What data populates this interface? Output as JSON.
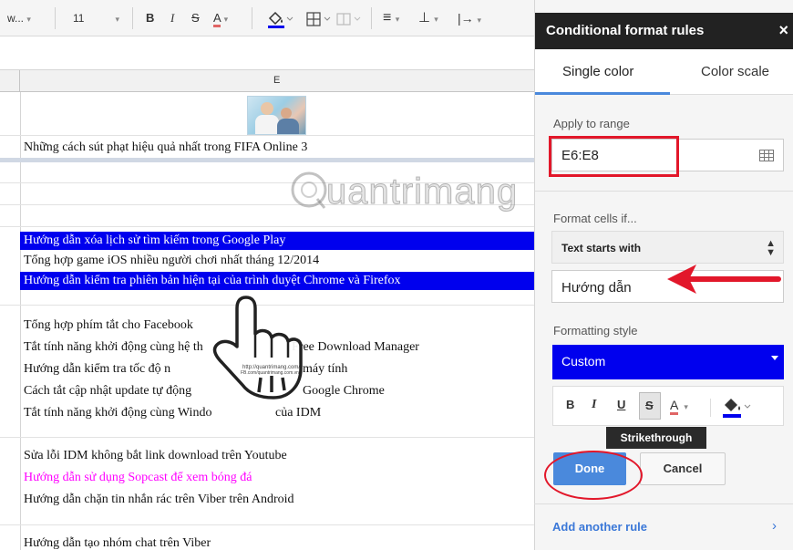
{
  "toolbar": {
    "font_name": "w...",
    "font_size": "11",
    "bold": "B",
    "italic": "I",
    "strike": "S",
    "text_color": "A",
    "align": "≡",
    "valign": "⊥",
    "wrap": "|→"
  },
  "sheet": {
    "column_header": "E",
    "rows": [
      "Những cách sút phạt hiệu quả nhất trong FIFA Online 3",
      "Hướng dẫn xóa lịch sử tìm kiếm trong Google Play",
      "Tổng hợp game iOS nhiều người chơi nhất tháng 12/2014",
      "Hướng dẫn kiểm tra phiên bản hiện tại của trình duyệt Chrome và Firefox",
      "Tổng hợp phím tắt cho Facebook",
      "Tắt tính năng khởi động cùng hệ th",
      "Free Download Manager",
      "Hướng dẫn kiểm tra tốc độ n",
      "máy tính",
      "Cách tắt cập nhật update tự động",
      "Google Chrome",
      "Tắt tính năng khởi động cùng Windo",
      "của IDM",
      "Sửa lỗi IDM không bắt link download trên Youtube",
      "Hướng dẫn sử dụng Sopcast để xem bóng đá",
      "Hướng dẫn chặn tin nhắn rác trên Viber trên Android",
      "Hướng dẫn tạo nhóm chat trên Viber"
    ],
    "highlight_color": "#0000ee",
    "magenta_color": "#ff00ff"
  },
  "watermark": "uantrimang",
  "panel": {
    "title": "Conditional format rules",
    "close": "×",
    "tabs": [
      "Single color",
      "Color scale"
    ],
    "apply_label": "Apply to range",
    "range_value": "E6:E8",
    "format_if_label": "Format cells if...",
    "condition": "Text starts with",
    "condition_value": "Hướng dẫn",
    "style_label": "Formatting style",
    "style_value": "Custom",
    "fmt_buttons": [
      "B",
      "I",
      "U",
      "S",
      "A"
    ],
    "tooltip": "Strikethrough",
    "done": "Done",
    "cancel": "Cancel",
    "add_rule": "Add another rule",
    "add_chevron": "›",
    "accent_color": "#4a89dc",
    "annotation_color": "#e2172a"
  }
}
